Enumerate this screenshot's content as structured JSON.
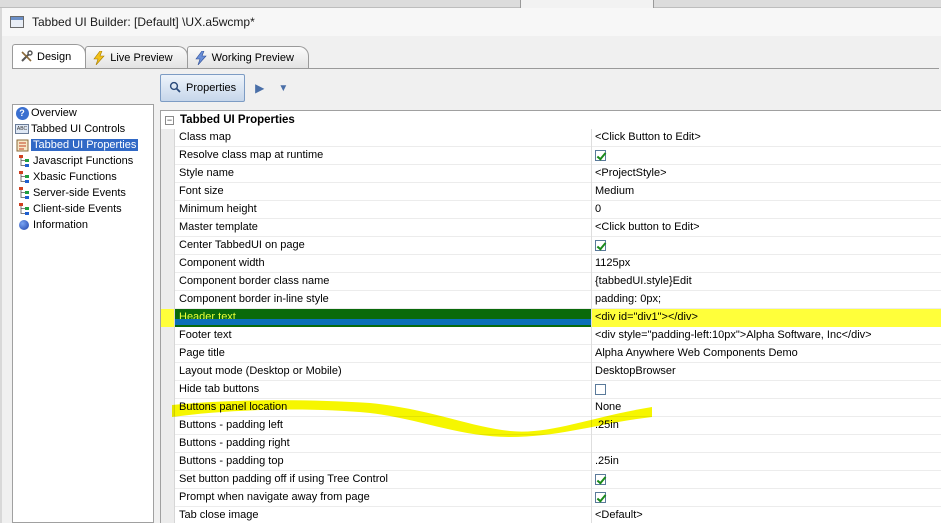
{
  "window": {
    "title": "Tabbed UI Builder: [Default] \\UX.a5wcmp*"
  },
  "tabs": [
    {
      "label": "Design",
      "icon": "tools-icon"
    },
    {
      "label": "Live Preview",
      "icon": "lightning-icon"
    },
    {
      "label": "Working Preview",
      "icon": "lightning-icon"
    }
  ],
  "toolbar": {
    "properties_label": "Properties"
  },
  "nav": [
    {
      "label": "Overview",
      "icon": "help-icon"
    },
    {
      "label": "Tabbed UI Controls",
      "icon": "abc-icon"
    },
    {
      "label": "Tabbed UI Properties",
      "icon": "properties-icon"
    },
    {
      "label": "Javascript Functions",
      "icon": "tree-icon"
    },
    {
      "label": "Xbasic Functions",
      "icon": "tree-icon"
    },
    {
      "label": "Server-side Events",
      "icon": "tree-icon"
    },
    {
      "label": "Client-side Events",
      "icon": "tree-icon"
    },
    {
      "label": "Information",
      "icon": "info-dot-icon"
    }
  ],
  "grid": {
    "section_title": "Tabbed UI Properties",
    "rows": [
      {
        "name": "Class map",
        "value": "<Click Button to Edit>"
      },
      {
        "name": "Resolve class map at runtime",
        "checked": true
      },
      {
        "name": "Style name",
        "value": "<ProjectStyle>"
      },
      {
        "name": "Font size",
        "value": "Medium"
      },
      {
        "name": "Minimum height",
        "value": "0"
      },
      {
        "name": "Master template",
        "value": "<Click button to Edit>"
      },
      {
        "name": "Center TabbedUI on page",
        "checked": true
      },
      {
        "name": "Component width",
        "value": "1125px"
      },
      {
        "name": "Component border class name",
        "value": "{tabbedUI.style}Edit"
      },
      {
        "name": "Component border in-line style",
        "value": "padding: 0px;"
      },
      {
        "name": "Header text",
        "value": "<div id=\"div1\"></div>"
      },
      {
        "name": "Footer text",
        "value": "<div style=\"padding-left:10px\">Alpha Software, Inc</div>"
      },
      {
        "name": "Page title",
        "value": "Alpha Anywhere Web Components Demo"
      },
      {
        "name": "Layout mode (Desktop or Mobile)",
        "value": "DesktopBrowser"
      },
      {
        "name": "Hide tab buttons",
        "checked": false
      },
      {
        "name": "Buttons panel location",
        "value": "None"
      },
      {
        "name": "Buttons - padding left",
        "value": ".25in"
      },
      {
        "name": "Buttons - padding right",
        "value": ""
      },
      {
        "name": "Buttons - padding top",
        "value": ".25in"
      },
      {
        "name": "Set button padding off if using Tree Control",
        "checked": true
      },
      {
        "name": "Prompt when navigate away from page",
        "checked": true
      },
      {
        "name": "Tab close image",
        "value": "<Default>"
      }
    ]
  },
  "colors": {
    "highlight": "#ffff3a",
    "selection_green": "#0a6a0a",
    "nav_selection": "#3169c6"
  }
}
